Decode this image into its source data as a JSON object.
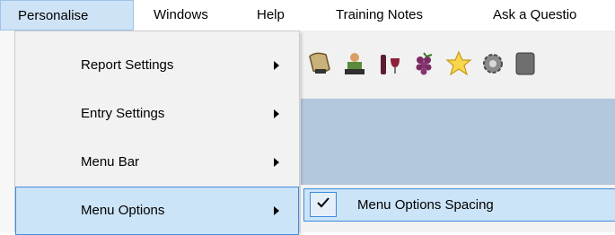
{
  "menubar": {
    "items": [
      {
        "label": "Personalise"
      },
      {
        "label": "Windows"
      },
      {
        "label": "Help"
      },
      {
        "label": "Training Notes"
      },
      {
        "label": "Ask a Questio"
      }
    ]
  },
  "dropdown": {
    "items": [
      {
        "label": "Report Settings"
      },
      {
        "label": "Entry Settings"
      },
      {
        "label": "Menu Bar"
      },
      {
        "label": "Menu Options"
      }
    ]
  },
  "submenu": {
    "items": [
      {
        "label": "Menu Options Spacing",
        "checked": true
      }
    ]
  },
  "toolbar": {
    "icons": [
      "scroll-icon",
      "reader-icon",
      "wine-bottle-glass-icon",
      "grapes-icon",
      "star-icon",
      "gear-icon",
      "toolbar-button-partial-icon"
    ]
  },
  "colors": {
    "highlight_bg": "#cce4f7",
    "highlight_border": "#3e8ddc",
    "content_band": "#b3c7dd",
    "menu_bg": "#f2f2f2"
  }
}
